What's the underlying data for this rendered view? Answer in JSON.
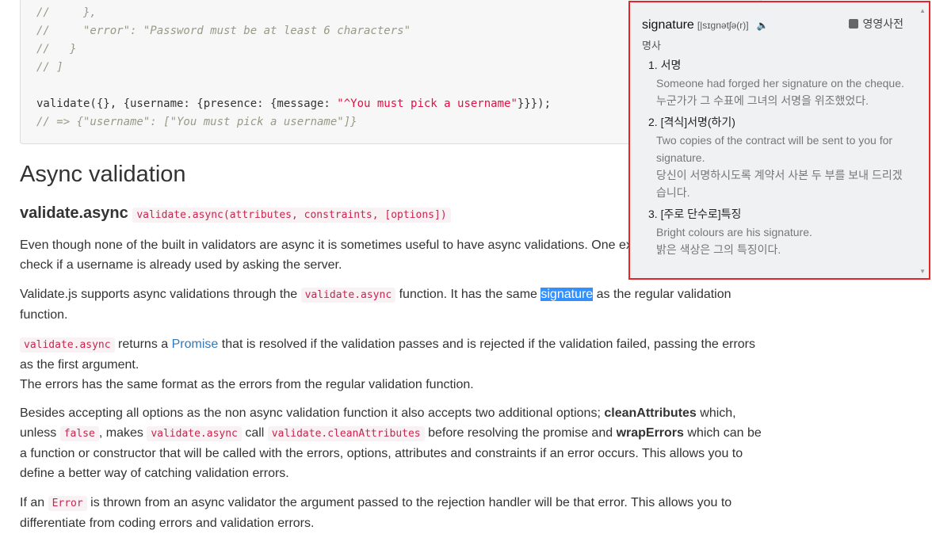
{
  "code": {
    "lines": [
      "//     },",
      "//     \"error\": \"Password must be at least 6 characters\"",
      "//   }",
      "// ]",
      "",
      "validate({}, {username: {presence: {message: ",
      "\"^You must pick a username\"",
      "}}});",
      "// => {\"username\": [\"You must pick a username\"]}"
    ]
  },
  "heading": "Async validation",
  "subheading": "validate.async",
  "signature_code": "validate.async(attributes, constraints, [options])",
  "p1": "Even though none of the built in validators are async it is sometimes useful to have async validations. One example would be to check if a username is already used by asking the server.",
  "p2": {
    "a": "Validate.js supports async validations through the ",
    "code": "validate.async",
    "b": " function. It has the same ",
    "hl": "signature",
    "c": " as the regular validation function."
  },
  "p3": {
    "code": "validate.async",
    "a": " returns a ",
    "link": "Promise",
    "b": " that is resolved if the validation passes and is rejected if the validation failed, passing the errors as the first argument.",
    "c": "The errors has the same format as the errors from the regular validation function."
  },
  "p4": {
    "a": "Besides accepting all options as the non async validation function it also accepts two additional options; ",
    "b1": "cleanAttributes",
    "c": " which, unless ",
    "code1": "false",
    "d": ", makes ",
    "code2": "validate.async",
    "e": " call ",
    "code3": "validate.cleanAttributes",
    "f": " before resolving the promise and ",
    "b2": "wrapErrors",
    "g": " which can be a function or constructor that will be called with the errors, options, attributes and constraints if an error occurs. This allows you to define a better way of catching validation errors."
  },
  "p5": {
    "a": "If an ",
    "code": "Error",
    "b": " is thrown from an async validator the argument passed to the rejection handler will be that error. This allows you to differentiate from coding errors and validation errors."
  },
  "popup": {
    "word": "signature",
    "pronunciation": "[|sɪɡnətʃə(r)]",
    "dict_label": "영영사전",
    "pos": "명사",
    "senses": [
      {
        "label": "1. 서명",
        "examples": [
          "Someone had forged her signature on the cheque.",
          "누군가가 그 수표에 그녀의 서명을 위조했었다."
        ]
      },
      {
        "label": "2. [격식]서명(하기)",
        "examples": [
          "Two copies of the contract will be sent to you for signature.",
          "당신이 서명하시도록 계약서 사본 두 부를 보내 드리겠습니다."
        ]
      },
      {
        "label": "3. [주로 단수로]특징",
        "examples": [
          "Bright colours are his signature.",
          "밝은 색상은 그의 특징이다."
        ]
      }
    ]
  }
}
